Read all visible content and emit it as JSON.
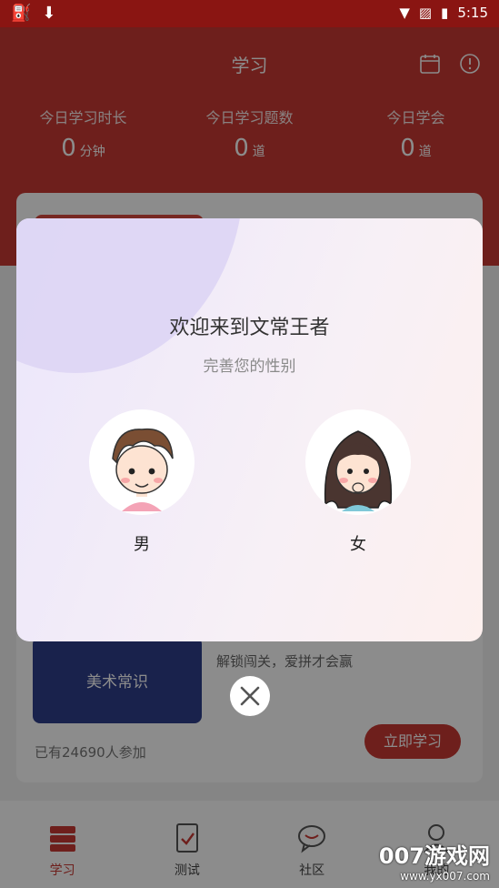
{
  "status_bar": {
    "time": "5:15"
  },
  "header": {
    "title": "学习",
    "stats": [
      {
        "label": "今日学习时长",
        "value": "0",
        "unit": "分钟"
      },
      {
        "label": "今日学习题数",
        "value": "0",
        "unit": "道"
      },
      {
        "label": "今日学会",
        "value": "0",
        "unit": "道"
      }
    ]
  },
  "course_card": {
    "cover_label": "美术常识",
    "subtitle": "解锁闯关，爱拼才会赢",
    "participants": "已有24690人参加",
    "start_button": "立即学习"
  },
  "tabs": [
    {
      "label": "学习"
    },
    {
      "label": "测试"
    },
    {
      "label": "社区"
    },
    {
      "label": "我的"
    }
  ],
  "dialog": {
    "title": "欢迎来到文常王者",
    "subtitle": "完善您的性别",
    "male_label": "男",
    "female_label": "女"
  },
  "watermark": {
    "line1": "007游戏网",
    "line2": "www.yx007.com"
  },
  "colors": {
    "primary_red": "#c93a33",
    "status_bar": "#8a1512",
    "cover_blue": "#2f3e8a"
  }
}
